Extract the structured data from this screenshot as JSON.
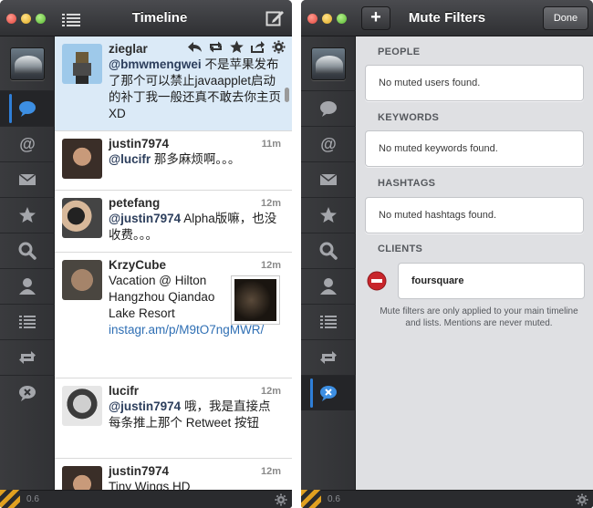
{
  "left_window": {
    "title": "Timeline",
    "version": "0.6",
    "tweets": [
      {
        "user": "zieglar",
        "time": "",
        "mention": "@bmwmengwei",
        "text": " 不是苹果发布了那个可以禁止javaapplet启动的补丁我一般还真不敢去你主页 XD",
        "link": ""
      },
      {
        "user": "justin7974",
        "time": "11m",
        "mention": "@lucifr",
        "text": " 那多麻烦啊。。。",
        "link": ""
      },
      {
        "user": "petefang",
        "time": "12m",
        "mention": "@justin7974",
        "text": " Alpha版嘛，也没收费。。。",
        "link": ""
      },
      {
        "user": "KrzyCube",
        "time": "12m",
        "mention": "",
        "text": "Vacation  @ Hilton Hangzhou Qiandao Lake Resort ",
        "link": "instagr.am/p/M9tO7ngMWR/"
      },
      {
        "user": "lucifr",
        "time": "12m",
        "mention": "@justin7974",
        "text": " 哦，我是直接点每条推上那个 Retweet 按钮",
        "link": ""
      },
      {
        "user": "justin7974",
        "time": "12m",
        "mention": "",
        "text": "Tiny Wings HD",
        "link": ""
      }
    ]
  },
  "right_window": {
    "title": "Mute Filters",
    "add_label": "+",
    "done_label": "Done",
    "version": "0.6",
    "sections": {
      "people": {
        "label": "PEOPLE",
        "empty": "No muted users found."
      },
      "keywords": {
        "label": "KEYWORDS",
        "empty": "No muted keywords found."
      },
      "hashtags": {
        "label": "HASHTAGS",
        "empty": "No muted hashtags found."
      },
      "clients": {
        "label": "CLIENTS",
        "items": [
          "foursquare"
        ]
      }
    },
    "note": "Mute filters are only applied to your main timeline and lists. Mentions are never muted."
  },
  "colors": {
    "accent": "#2f7fd8",
    "selected_row": "#dbeaf7",
    "remove_red": "#c8252b",
    "stripe": "#e0a020"
  },
  "icons": {
    "sidebar": [
      "timeline-bubble-icon",
      "mentions-at-icon",
      "messages-envelope-icon",
      "favorites-star-icon",
      "search-icon",
      "profile-person-icon",
      "lists-icon",
      "retweets-icon",
      "mute-bubble-icon"
    ]
  }
}
